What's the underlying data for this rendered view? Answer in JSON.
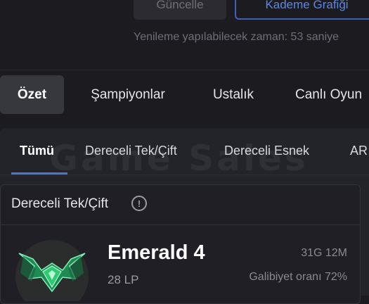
{
  "header": {
    "update_button": "Güncelle",
    "tier_graph_button": "Kademe Grafiği",
    "refresh_note": "Yenileme yapılabilecek zaman: 53 saniye"
  },
  "main_tabs": [
    {
      "label": "Özet",
      "active": true
    },
    {
      "label": "Şampiyonlar",
      "active": false
    },
    {
      "label": "Ustalık",
      "active": false
    },
    {
      "label": "Canlı Oyun",
      "active": false
    }
  ],
  "queue_tabs": [
    {
      "label": "Tümü",
      "active": true
    },
    {
      "label": "Dereceli Tek/Çift",
      "active": false
    },
    {
      "label": "Dereceli Esnek",
      "active": false
    },
    {
      "label": "AR",
      "active": false
    }
  ],
  "watermark": "Game Sales",
  "rank_card": {
    "title": "Dereceli Tek/Çift",
    "info_icon": "!",
    "tier": "Emerald 4",
    "lp": "28 LP",
    "record": "31G 12M",
    "winrate": "Galibiyet oranı 72%",
    "emblem_color": "#2ecc71"
  }
}
